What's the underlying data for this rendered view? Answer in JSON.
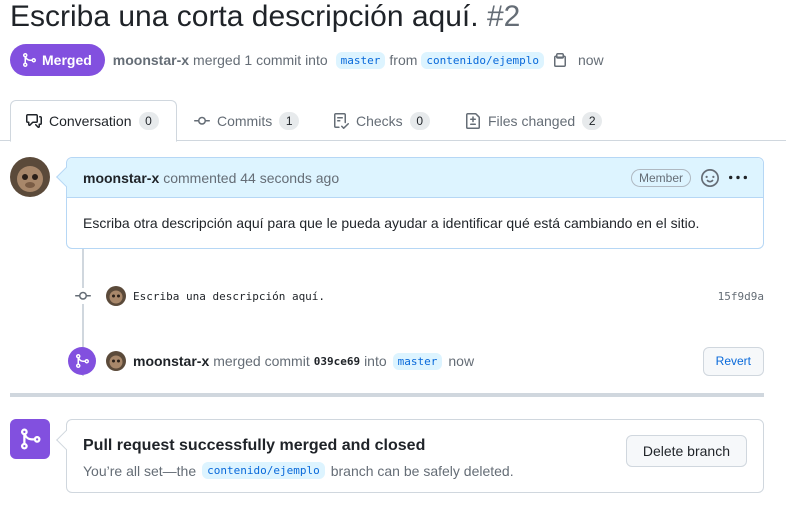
{
  "pr": {
    "title": "Escriba una corta descripción aquí.",
    "number": "#2",
    "state": "Merged",
    "author": "moonstar-x",
    "merged_text": "merged 1 commit into",
    "base_branch": "master",
    "from_text": "from",
    "head_branch": "contenido/ejemplo",
    "time": "now"
  },
  "tabs": [
    {
      "label": "Conversation",
      "count": "0",
      "icon": "comment-discussion-icon"
    },
    {
      "label": "Commits",
      "count": "1",
      "icon": "git-commit-icon"
    },
    {
      "label": "Checks",
      "count": "0",
      "icon": "checklist-icon"
    },
    {
      "label": "Files changed",
      "count": "2",
      "icon": "file-diff-icon"
    }
  ],
  "comment": {
    "author": "moonstar-x",
    "action": "commented 44 seconds ago",
    "role": "Member",
    "body": "Escriba otra descripción aquí para que le pueda ayudar a identificar qué está cambiando en el sitio."
  },
  "commit": {
    "message": "Escriba una descripción aquí.",
    "sha": "15f9d9a"
  },
  "merge_event": {
    "author": "moonstar-x",
    "text": "merged commit",
    "sha": "039ce69",
    "into_text": "into",
    "branch": "master",
    "time": "now",
    "revert_label": "Revert"
  },
  "merged_box": {
    "title": "Pull request successfully merged and closed",
    "sub_prefix": "You’re all set—the",
    "branch": "contenido/ejemplo",
    "sub_suffix": "branch can be safely deleted.",
    "delete_label": "Delete branch"
  },
  "colors": {
    "merged_purple": "#8250df",
    "link_blue": "#0969da",
    "comment_header_bg": "#ddf4ff"
  }
}
